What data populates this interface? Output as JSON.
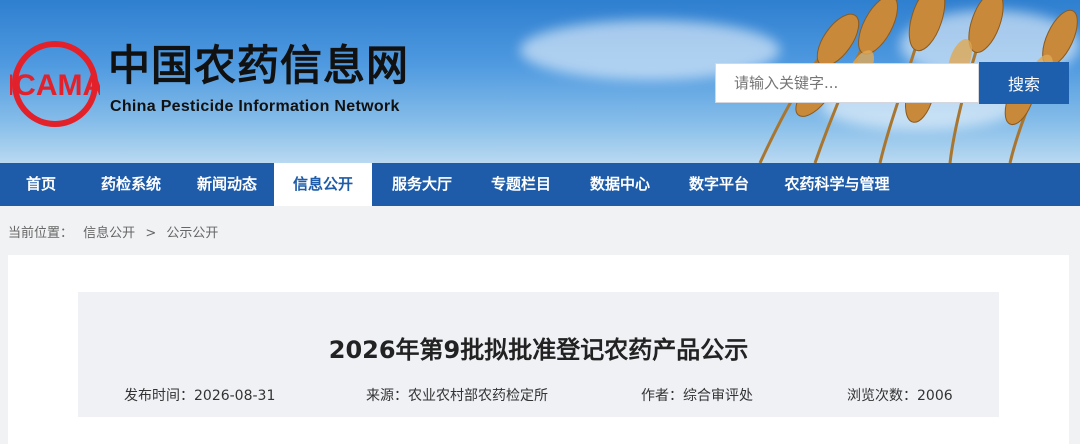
{
  "header": {
    "site_title": "中国农药信息网",
    "site_subtitle": "China Pesticide Information Network",
    "logo_text": "ICAMA"
  },
  "search": {
    "placeholder": "请输入关键字...",
    "button_label": "搜索"
  },
  "nav": {
    "items": [
      {
        "label": "首页"
      },
      {
        "label": "药检系统"
      },
      {
        "label": "新闻动态"
      },
      {
        "label": "信息公开",
        "active": true
      },
      {
        "label": "服务大厅"
      },
      {
        "label": "专题栏目"
      },
      {
        "label": "数据中心"
      },
      {
        "label": "数字平台"
      },
      {
        "label": "农药科学与管理"
      }
    ]
  },
  "breadcrumb": {
    "prefix": "当前位置：",
    "level1": "信息公开",
    "separator": ">",
    "level2": "公示公开"
  },
  "article": {
    "title": "2026年第9批拟批准登记农药产品公示",
    "publish_time": "发布时间：2026-08-31",
    "source": "来源：农业农村部农药检定所",
    "author": "作者：综合审评处",
    "views": "浏览次数：2006"
  },
  "colors": {
    "nav_bg": "#1e5ca9",
    "search_button": "#1e5fad",
    "logo_red": "#e3212a"
  }
}
